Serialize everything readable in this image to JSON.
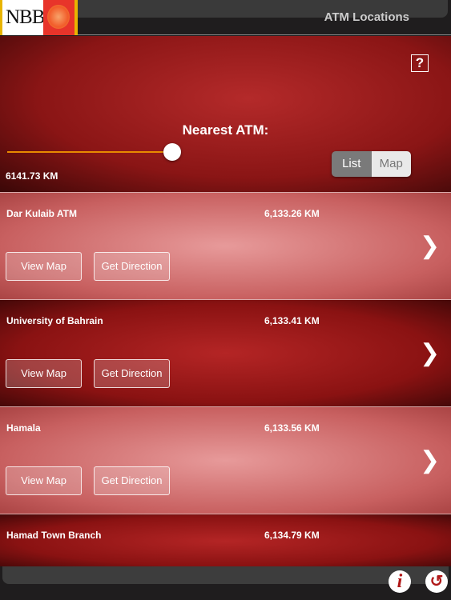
{
  "header": {
    "logo_text": "NBB",
    "title": "ATM Locations"
  },
  "filter": {
    "help_label": "?",
    "nearest_label": "Nearest ATM:",
    "slider_fraction": 0.5,
    "distance": "6141.73 KM",
    "segments": [
      {
        "label": "List",
        "selected": true
      },
      {
        "label": "Map",
        "selected": false
      }
    ]
  },
  "atms": [
    {
      "name": "Dar Kulaib ATM",
      "distance": "6,133.26 KM",
      "view_map": "View Map",
      "get_direction": "Get Direction"
    },
    {
      "name": "University of Bahrain",
      "distance": "6,133.41 KM",
      "view_map": "View Map",
      "get_direction": "Get Direction"
    },
    {
      "name": "Hamala",
      "distance": "6,133.56 KM",
      "view_map": "View Map",
      "get_direction": "Get Direction"
    },
    {
      "name": "Hamad Town Branch",
      "distance": "6,134.79 KM"
    }
  ],
  "footer": {
    "info_icon": "i",
    "back_icon": "↺"
  },
  "colors": {
    "accent": "#e88a00",
    "brand_red": "#b01818"
  }
}
